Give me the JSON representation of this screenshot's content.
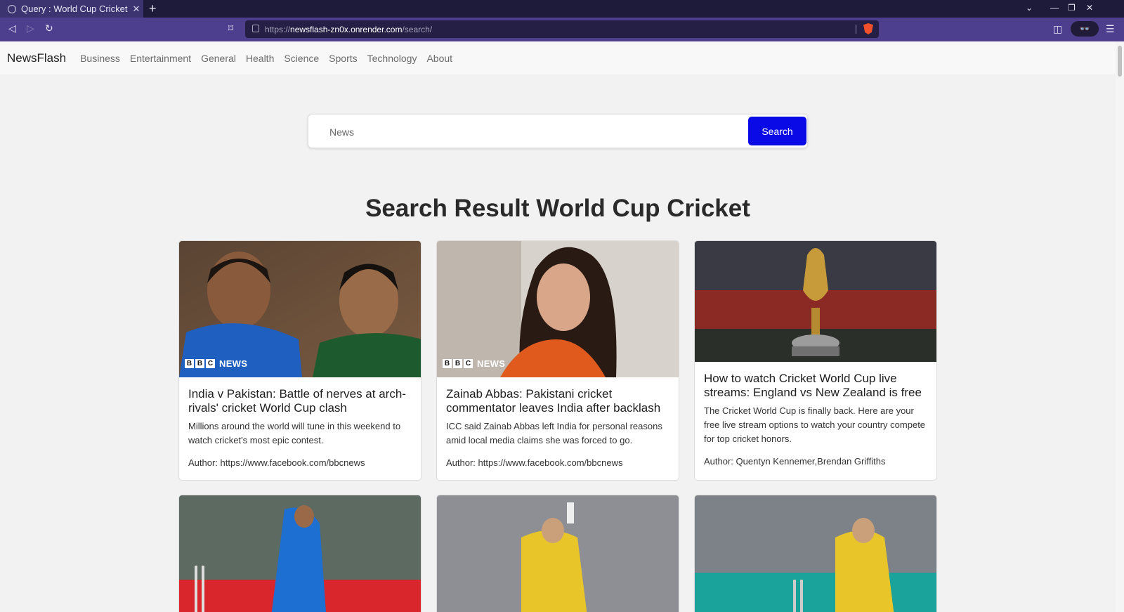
{
  "browser": {
    "tab_title": "Query : World Cup Cricket",
    "url_prefix": "https://",
    "url_host": "newsflash-zn0x.onrender.com",
    "url_path": "/search/"
  },
  "nav": {
    "brand": "NewsFlash",
    "links": [
      "Business",
      "Entertainment",
      "General",
      "Health",
      "Science",
      "Sports",
      "Technology",
      "About"
    ]
  },
  "search": {
    "placeholder": "News",
    "button_label": "Search"
  },
  "results_heading": "Search Result World Cup Cricket",
  "articles": [
    {
      "title": "India v Pakistan: Battle of nerves at arch-rivals' cricket World Cup clash",
      "description": "Millions around the world will tune in this weekend to watch cricket's most epic contest.",
      "author": "Author: https://www.facebook.com/bbcnews",
      "badge": "NEWS"
    },
    {
      "title": "Zainab Abbas: Pakistani cricket commentator leaves India after backlash",
      "description": "ICC said Zainab Abbas left India for personal reasons amid local media claims she was forced to go.",
      "author": "Author: https://www.facebook.com/bbcnews",
      "badge": "NEWS"
    },
    {
      "title": "How to watch Cricket World Cup live streams: England vs New Zealand is free",
      "description": "The Cricket World Cup is finally back. Here are your free live stream options to watch your country compete for top cricket honors.",
      "author": "Author: Quentyn Kennemer,Brendan Griffiths"
    }
  ],
  "colors": {
    "accent": "#0a0ae6",
    "browser_toolbar": "#4d3f8e",
    "tabbar": "#1e1b3a"
  }
}
